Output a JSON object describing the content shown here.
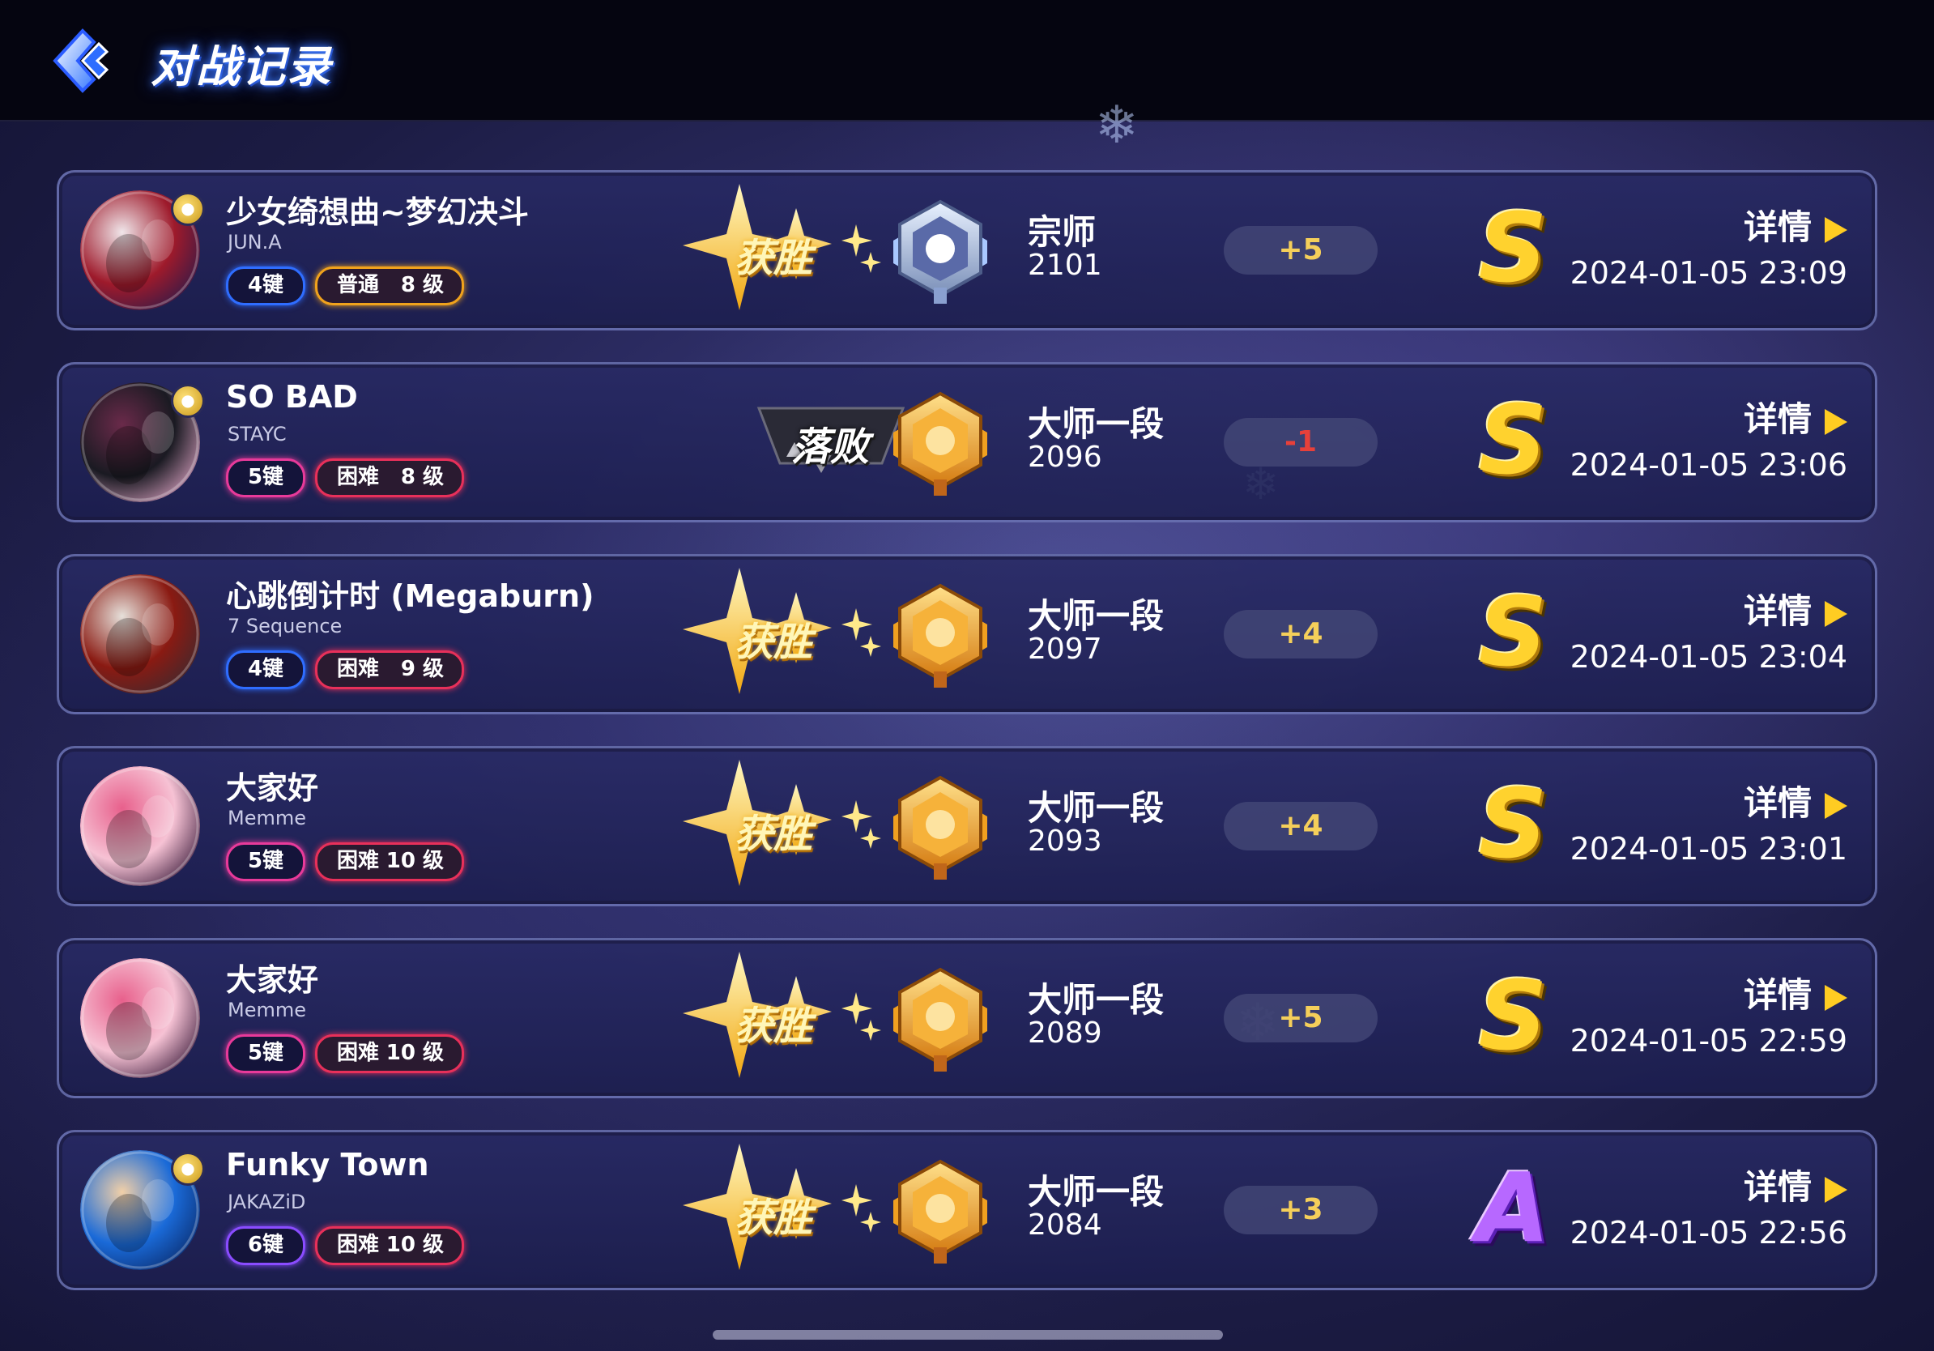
{
  "header": {
    "title": "对战记录"
  },
  "records": [
    {
      "title": "少女绮想曲~梦幻决斗",
      "artist": "JUN.A",
      "keys": "4键",
      "key_color": "#2f6dff",
      "difficulty": "普通",
      "level": "8 级",
      "diff_color": "#f0a21c",
      "result": "获胜",
      "outcome": "win",
      "rank": "宗师",
      "score": "2101",
      "rank_tier": "grandmaster",
      "delta": "+5",
      "delta_sign": "pos",
      "grade": "S",
      "detail": "详情",
      "time": "2024-01-05 23:09",
      "cover_colors": [
        "#9e1a2b",
        "#f0e6ea",
        "#2a1a4a"
      ]
    },
    {
      "title": "SO BAD",
      "artist": "STAYC",
      "keys": "5键",
      "key_color": "#e83a9a",
      "difficulty": "困难",
      "level": "8 级",
      "diff_color": "#e8305a",
      "result": "落败",
      "outcome": "lose",
      "rank": "大师一段",
      "score": "2096",
      "rank_tier": "master",
      "delta": "-1",
      "delta_sign": "neg",
      "grade": "S",
      "detail": "详情",
      "time": "2024-01-05 23:06",
      "cover_colors": [
        "#1a1a22",
        "#6a2a4a",
        "#d8a0c0"
      ]
    },
    {
      "title": "心跳倒计时 (Megaburn)",
      "artist": "7 Sequence",
      "keys": "4键",
      "key_color": "#2f6dff",
      "difficulty": "困难",
      "level": "9 级",
      "diff_color": "#e8305a",
      "result": "获胜",
      "outcome": "win",
      "rank": "大师一段",
      "score": "2097",
      "rank_tier": "master",
      "delta": "+4",
      "delta_sign": "pos",
      "grade": "S",
      "detail": "详情",
      "time": "2024-01-05 23:04",
      "cover_colors": [
        "#8a1a12",
        "#e6e0da",
        "#3a2a30"
      ]
    },
    {
      "title": "大家好",
      "artist": "Memme",
      "keys": "5键",
      "key_color": "#e83a9a",
      "difficulty": "困难",
      "level": "10 级",
      "diff_color": "#e8305a",
      "result": "获胜",
      "outcome": "win",
      "rank": "大师一段",
      "score": "2093",
      "rank_tier": "master",
      "delta": "+4",
      "delta_sign": "pos",
      "grade": "S",
      "detail": "详情",
      "time": "2024-01-05 23:01",
      "cover_colors": [
        "#f6c2d4",
        "#e8608c",
        "#3a1a3a"
      ]
    },
    {
      "title": "大家好",
      "artist": "Memme",
      "keys": "5键",
      "key_color": "#e83a9a",
      "difficulty": "困难",
      "level": "10 级",
      "diff_color": "#e8305a",
      "result": "获胜",
      "outcome": "win",
      "rank": "大师一段",
      "score": "2089",
      "rank_tier": "master",
      "delta": "+5",
      "delta_sign": "pos",
      "grade": "S",
      "detail": "详情",
      "time": "2024-01-05 22:59",
      "cover_colors": [
        "#f6c2d4",
        "#e8608c",
        "#3a1a3a"
      ]
    },
    {
      "title": "Funky Town",
      "artist": "JAKAZiD",
      "keys": "6键",
      "key_color": "#8a4cff",
      "difficulty": "困难",
      "level": "10 级",
      "diff_color": "#e8305a",
      "result": "获胜",
      "outcome": "win",
      "rank": "大师一段",
      "score": "2084",
      "rank_tier": "master",
      "delta": "+3",
      "delta_sign": "pos",
      "grade": "A",
      "detail": "详情",
      "time": "2024-01-05 22:56",
      "cover_colors": [
        "#1a6ad8",
        "#f2d0a8",
        "#0a2a6a"
      ]
    }
  ]
}
